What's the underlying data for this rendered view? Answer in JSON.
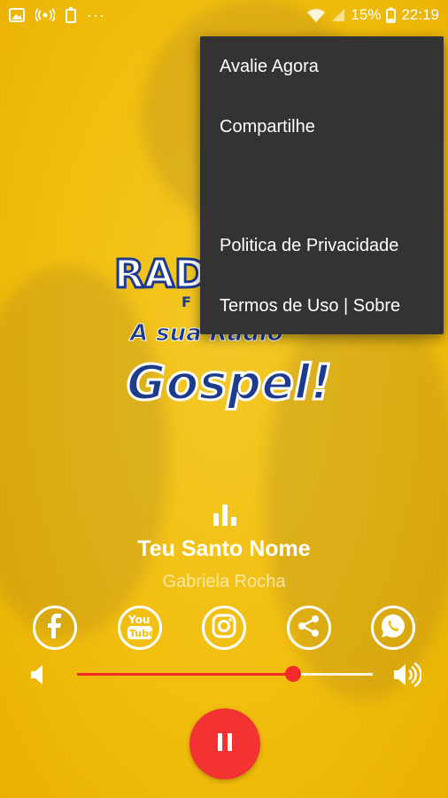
{
  "status_bar": {
    "battery_percent": "15%",
    "time": "22:19",
    "overflow": "···"
  },
  "logo": {
    "text_top": "RAD",
    "text_fm": "F",
    "tagline": "A sua Rádio",
    "word": "Gospel!"
  },
  "menu": {
    "items": [
      {
        "label": "Avalie Agora"
      },
      {
        "label": "Compartilhe"
      },
      {
        "label": ""
      },
      {
        "label": "Politica de Privacidade"
      },
      {
        "label": "Termos de Uso | Sobre"
      }
    ]
  },
  "player": {
    "title": "Teu Santo Nome",
    "artist": "Gabriela Rocha",
    "volume": 0.73,
    "state": "playing"
  },
  "social": [
    {
      "name": "facebook-icon"
    },
    {
      "name": "youtube-icon"
    },
    {
      "name": "instagram-icon"
    },
    {
      "name": "share-icon"
    },
    {
      "name": "whatsapp-icon"
    }
  ],
  "colors": {
    "background": "#f2be0f",
    "accent": "#f33232",
    "menu_bg": "#333333",
    "logo_blue": "#1d3b8c"
  }
}
